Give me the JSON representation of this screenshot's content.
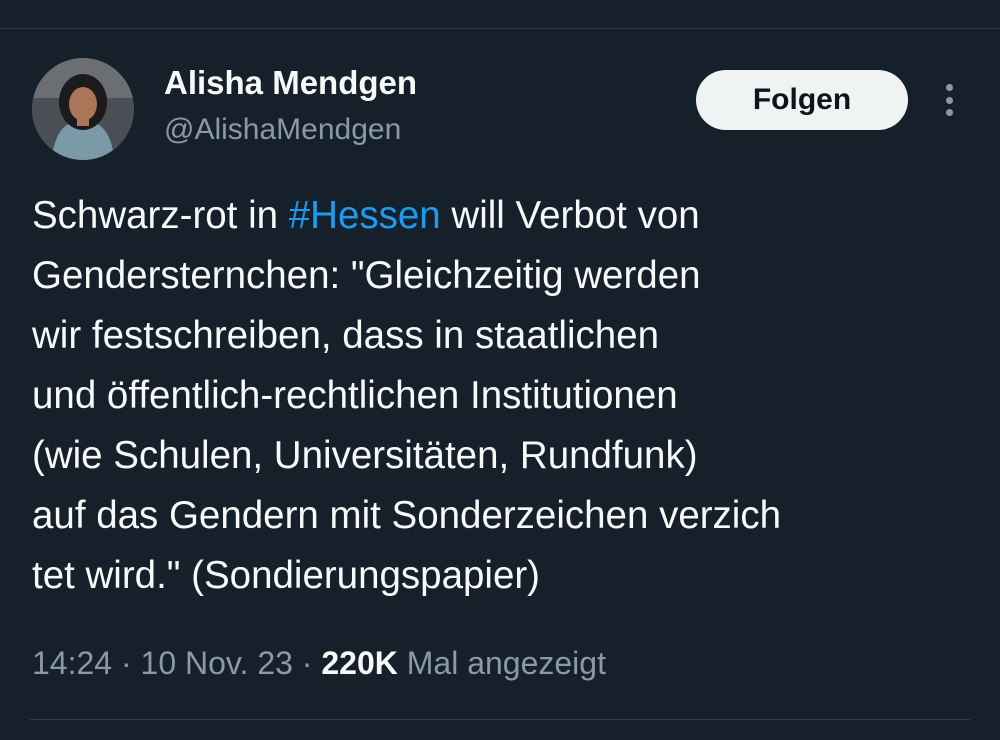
{
  "author": {
    "display_name": "Alisha Mendgen",
    "handle": "@AlishaMendgen"
  },
  "follow_button": {
    "label": "Folgen"
  },
  "more_button": {
    "icon": "more-vertical-icon"
  },
  "tweet": {
    "lines": [
      {
        "before": "Schwarz-rot in ",
        "hashtag": "#Hessen",
        "after": " will Verbot von"
      },
      {
        "text": "Gendersternchen: \"Gleichzeitig werden"
      },
      {
        "text": "wir festschreiben, dass in staatlichen"
      },
      {
        "text": "und öffentlich-rechtlichen Institutionen"
      },
      {
        "text": "(wie Schulen, Universitäten, Rundfunk)"
      },
      {
        "text": "auf das Gendern mit Sonderzeichen verzich"
      },
      {
        "text": "tet wird.\" (Sondierungspapier)"
      }
    ]
  },
  "meta": {
    "time": "14:24",
    "separator": " · ",
    "date": "10 Nov. 23",
    "views_count": "220K",
    "views_label": " Mal angezeigt"
  },
  "colors": {
    "background": "#15202b",
    "text": "#f7f9f9",
    "secondary": "#8b98a5",
    "link": "#1d9bf0",
    "button_bg": "#eff3f4"
  }
}
